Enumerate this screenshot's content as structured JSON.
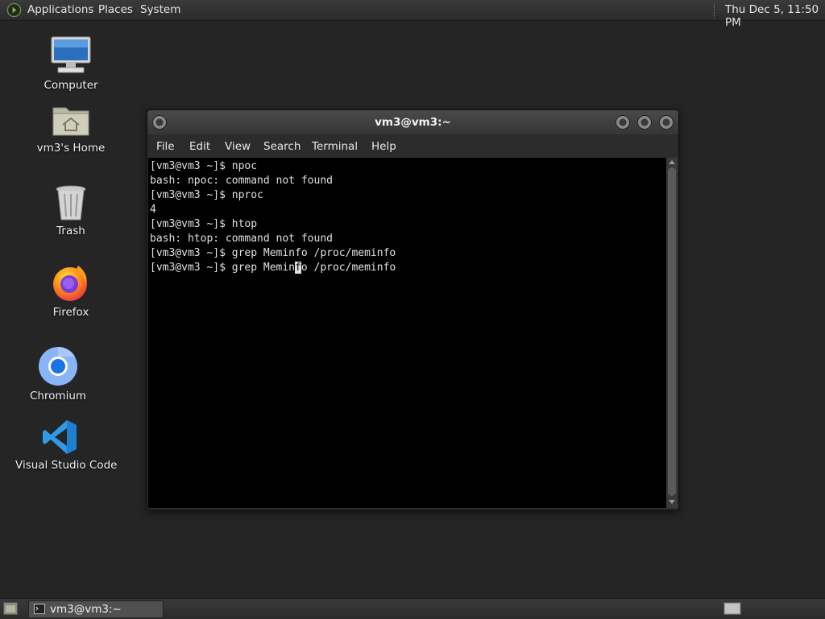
{
  "top_panel": {
    "menus": [
      "Applications",
      "Places",
      "System"
    ],
    "clock": "Thu Dec  5, 11:50 PM"
  },
  "desktop_icons": [
    {
      "label": "Computer",
      "icon": "computer-icon"
    },
    {
      "label": "vm3's Home",
      "icon": "home-folder-icon"
    },
    {
      "label": "Trash",
      "icon": "trash-icon"
    },
    {
      "label": "Firefox",
      "icon": "firefox-icon"
    },
    {
      "label": "Chromium",
      "icon": "chromium-icon"
    },
    {
      "label": "Visual Studio Code",
      "icon": "vscode-icon"
    }
  ],
  "terminal": {
    "title": "vm3@vm3:~",
    "menu": [
      "File",
      "Edit",
      "View",
      "Search",
      "Terminal",
      "Help"
    ],
    "lines": [
      "[vm3@vm3 ~]$ npoc",
      "bash: npoc: command not found",
      "[vm3@vm3 ~]$ nproc",
      "4",
      "[vm3@vm3 ~]$ htop",
      "bash: htop: command not found",
      "[vm3@vm3 ~]$ grep Meminfo /proc/meminfo"
    ],
    "current_line": {
      "before_cursor": "[vm3@vm3 ~]$ grep Memin",
      "cursor_char": "f",
      "after_cursor": "o /proc/meminfo"
    }
  },
  "taskbar": {
    "window_button": "vm3@vm3:~"
  },
  "colors": {
    "desktop_bg": "#252525",
    "terminal_bg": "#000000",
    "terminal_fg": "#e0e0e0",
    "chromium_blue": "#1a73e8",
    "vscode_blue": "#2f9ae8"
  }
}
